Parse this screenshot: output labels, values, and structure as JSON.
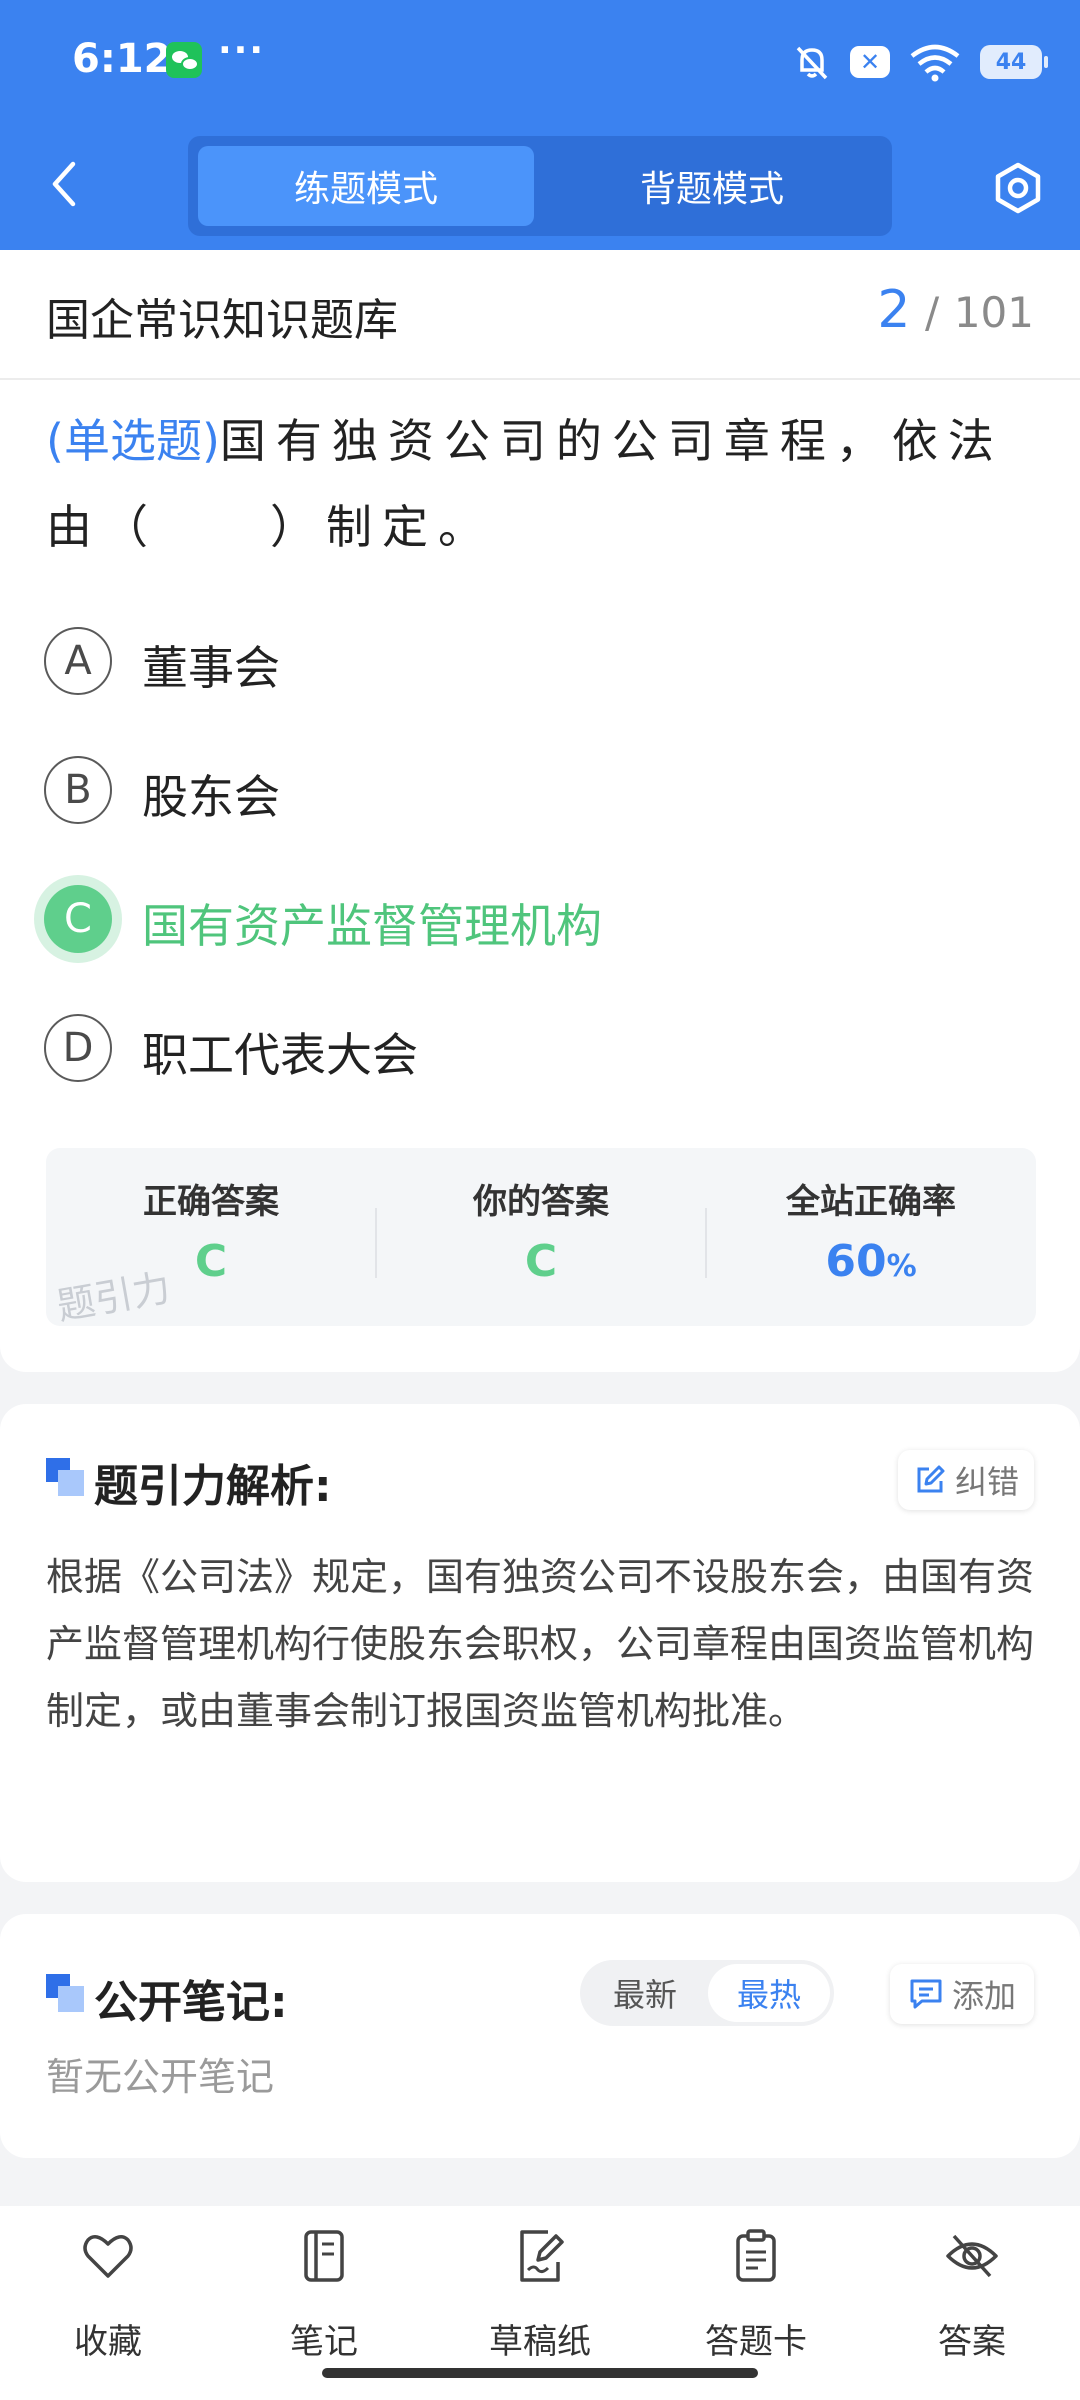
{
  "status_bar": {
    "time": "6:12",
    "more": "···",
    "battery": "44",
    "x_badge": "✕"
  },
  "header": {
    "tabs": [
      {
        "label": "练题模式",
        "active": true
      },
      {
        "label": "背题模式",
        "active": false
      }
    ],
    "accent_color": "#3b82f0"
  },
  "bank": {
    "title": "国企常识知识题库",
    "current": "2",
    "separator": "/",
    "total": "101"
  },
  "question": {
    "type_label": "(单选题)",
    "text": "国有独资公司的公司章程，依法由（　　）制定。"
  },
  "options": [
    {
      "letter": "A",
      "text": "董事会",
      "state": "normal"
    },
    {
      "letter": "B",
      "text": "股东会",
      "state": "normal"
    },
    {
      "letter": "C",
      "text": "国有资产监督管理机构",
      "state": "correct"
    },
    {
      "letter": "D",
      "text": "职工代表大会",
      "state": "normal"
    }
  ],
  "answer_summary": {
    "correct_label": "正确答案",
    "correct_value": "C",
    "yours_label": "你的答案",
    "yours_value": "C",
    "rate_label": "全站正确率",
    "rate_value": "60",
    "rate_unit": "%",
    "watermark": "题引力"
  },
  "analysis": {
    "title": "题引力解析:",
    "report_label": "纠错",
    "text": "根据《公司法》规定，国有独资公司不设股东会，由国有资产监督管理机构行使股东会职权，公司章程由国资监管机构制定，或由董事会制订报国资监管机构批准。"
  },
  "notes": {
    "title": "公开笔记:",
    "sort_latest": "最新",
    "sort_hot": "最热",
    "add_label": "添加",
    "empty_text": "暂无公开笔记"
  },
  "bottom_nav": [
    {
      "label": "收藏",
      "icon": "heart-icon"
    },
    {
      "label": "笔记",
      "icon": "notebook-icon"
    },
    {
      "label": "草稿纸",
      "icon": "draft-paper-icon"
    },
    {
      "label": "答题卡",
      "icon": "answer-card-icon"
    },
    {
      "label": "答案",
      "icon": "eye-off-icon"
    }
  ],
  "colors": {
    "correct_green": "#5fcf8c",
    "primary_blue": "#3b82f0"
  }
}
